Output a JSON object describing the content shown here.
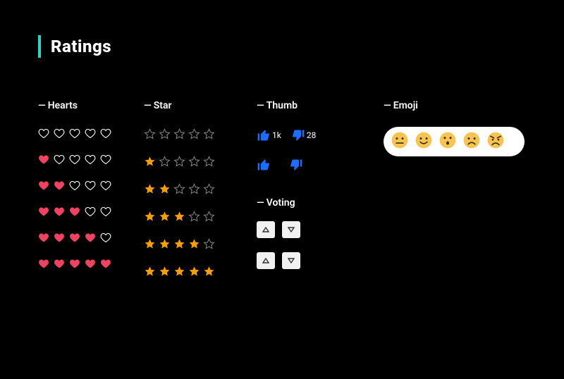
{
  "title": "Ratings",
  "sections": {
    "hearts": {
      "label": "Hearts",
      "rows": [
        0,
        1,
        2,
        3,
        4,
        5
      ]
    },
    "stars": {
      "label": "Star",
      "rows": [
        0,
        1,
        2,
        3,
        4,
        5
      ]
    },
    "thumb": {
      "label": "Thumb",
      "up_count": "1k",
      "down_count": "28"
    },
    "voting": {
      "label": "Voting"
    },
    "emoji": {
      "label": "Emoji"
    }
  }
}
